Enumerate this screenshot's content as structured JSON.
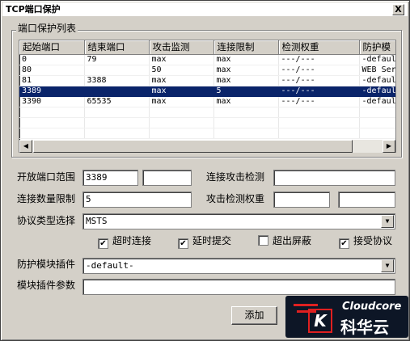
{
  "window": {
    "title": "TCP端口保护",
    "close_glyph": "X"
  },
  "group": {
    "label": "端口保护列表"
  },
  "table": {
    "columns": [
      "起始端口",
      "结束端口",
      "攻击监测",
      "连接限制",
      "检测权重",
      "防护模"
    ],
    "rows": [
      [
        "0",
        "79",
        "max",
        "max",
        "---/---",
        "-defaul"
      ],
      [
        "80",
        "",
        "50",
        "max",
        "---/---",
        "WEB Ser"
      ],
      [
        "81",
        "3388",
        "max",
        "max",
        "---/---",
        "-defaul"
      ],
      [
        "3389",
        "",
        "max",
        "5",
        "---/---",
        "-defaul"
      ],
      [
        "3390",
        "65535",
        "max",
        "max",
        "---/---",
        "-defaul"
      ]
    ],
    "selected_row": 3
  },
  "scrollbar": {
    "left_arrow": "◀",
    "right_arrow": "▶"
  },
  "form": {
    "open_port_label": "开放端口范围",
    "open_port_start": "3389",
    "open_port_end": "",
    "conn_attack_label": "连接攻击检测",
    "conn_attack_value": "",
    "conn_limit_label": "连接数量限制",
    "conn_limit_value": "5",
    "attack_weight_label": "攻击检测权重",
    "attack_weight_1": "",
    "attack_weight_2": "",
    "protocol_label": "协议类型选择",
    "protocol_value": "MSTS",
    "plugin_label": "防护模块插件",
    "plugin_value": "-default-",
    "plugin_param_label": "模块插件参数",
    "plugin_param_value": "",
    "dropdown_arrow": "▼"
  },
  "checkboxes": [
    {
      "label": "超时连接",
      "checked": true
    },
    {
      "label": "延时提交",
      "checked": true
    },
    {
      "label": "超出屏蔽",
      "checked": false
    },
    {
      "label": "接受协议",
      "checked": true
    }
  ],
  "check_glyph": "✔",
  "buttons": {
    "add": "添加"
  },
  "watermark": {
    "en": "Cloudcore",
    "k": "K",
    "cn": "科华云"
  }
}
